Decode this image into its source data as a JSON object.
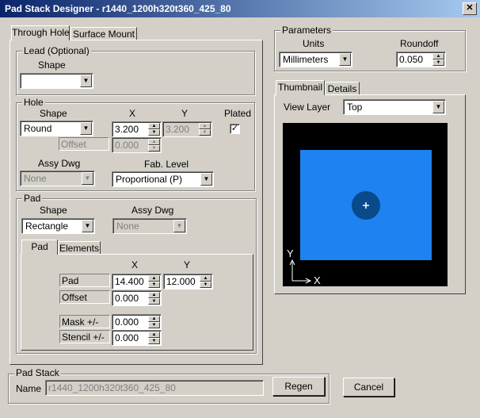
{
  "window": {
    "title": "Pad Stack Designer - r1440_1200h320t360_425_80",
    "close_glyph": "✕"
  },
  "left_tabs": [
    "Through Hole",
    "Surface Mount"
  ],
  "lead": {
    "group_label": "Lead (Optional)",
    "shape_label": "Shape",
    "shape_value": ""
  },
  "hole": {
    "group_label": "Hole",
    "shape_label": "Shape",
    "x_label": "X",
    "y_label": "Y",
    "plated_label": "Plated",
    "shape_value": "Round",
    "x_value": "3.200",
    "y_value": "3.200",
    "plated_checked": "✓",
    "offset_label": "Offset",
    "offset_value": "0.000",
    "assy_label": "Assy Dwg",
    "assy_value": "None",
    "fab_label": "Fab. Level",
    "fab_value": "Proportional (P)"
  },
  "pad": {
    "group_label": "Pad",
    "shape_label": "Shape",
    "shape_value": "Rectangle",
    "assy_label": "Assy Dwg",
    "assy_value": "None",
    "tabs": [
      "Pad",
      "Elements"
    ],
    "x_label": "X",
    "y_label": "Y",
    "pad_label": "Pad",
    "pad_x": "14.400",
    "pad_y": "12.000",
    "offset_label": "Offset",
    "offset_x": "0.000",
    "mask_label": "Mask +/-",
    "mask_value": "0.000",
    "stencil_label": "Stencil +/-",
    "stencil_value": "0.000"
  },
  "padstack": {
    "group_label": "Pad Stack",
    "name_label": "Name",
    "name_value": "r1440_1200h320t360_425_80",
    "regen_label": "Regen"
  },
  "cancel_label": "Cancel",
  "parameters": {
    "group_label": "Parameters",
    "units_label": "Units",
    "units_value": "Millimeters",
    "roundoff_label": "Roundoff",
    "roundoff_value": "0.050"
  },
  "thumbnail": {
    "tabs": [
      "Thumbnail",
      "Details"
    ],
    "view_layer_label": "View Layer",
    "view_layer_value": "Top",
    "axis_y": "Y",
    "axis_x": "X",
    "colors": {
      "background": "#000000",
      "pad": "#1e82f0",
      "hole": "#0a4a8a",
      "marker": "#ffffff"
    }
  }
}
